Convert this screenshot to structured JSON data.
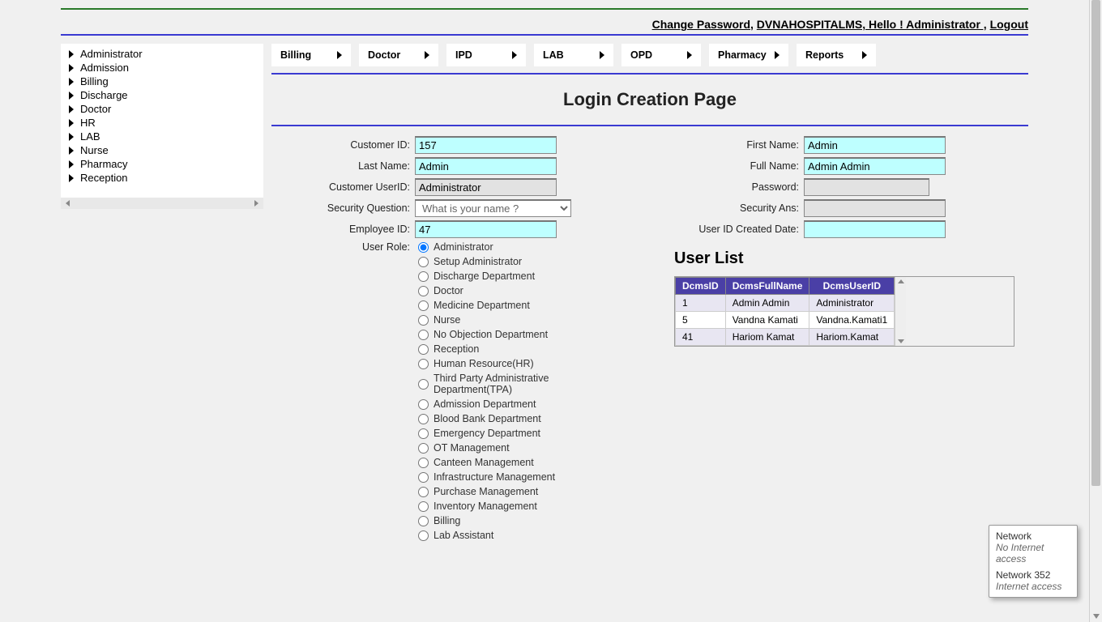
{
  "header": {
    "change_password": "Change Password",
    "title_and_greeting": "DVNAHOSPITALMS, Hello ! Administrator ,",
    "logout": "Logout"
  },
  "sidebar": {
    "items": [
      {
        "label": "Administrator"
      },
      {
        "label": "Admission"
      },
      {
        "label": "Billing"
      },
      {
        "label": "Discharge"
      },
      {
        "label": "Doctor"
      },
      {
        "label": "HR"
      },
      {
        "label": "LAB"
      },
      {
        "label": "Nurse"
      },
      {
        "label": "Pharmacy"
      },
      {
        "label": "Reception"
      }
    ]
  },
  "topmenu": [
    {
      "label": "Billing"
    },
    {
      "label": "Doctor"
    },
    {
      "label": "IPD"
    },
    {
      "label": "LAB"
    },
    {
      "label": "OPD"
    },
    {
      "label": "Pharmacy"
    },
    {
      "label": "Reports"
    }
  ],
  "page": {
    "title": "Login Creation Page"
  },
  "form": {
    "labels": {
      "customer_id": "Customer ID:",
      "first_name": "First Name:",
      "last_name": "Last Name:",
      "full_name": "Full Name:",
      "customer_userid": "Customer UserID:",
      "password": "Password:",
      "security_question": "Security Question:",
      "security_ans": "Security Ans:",
      "employee_id": "Employee ID:",
      "created_date": "User ID Created Date:",
      "user_role": "User Role:"
    },
    "values": {
      "customer_id": "157",
      "first_name": "Admin",
      "last_name": "Admin",
      "full_name": "Admin Admin",
      "customer_userid": "Administrator",
      "password": "",
      "security_question": "What is your name ?",
      "security_ans": "",
      "employee_id": "47",
      "created_date": ""
    },
    "roles": [
      "Administrator",
      "Setup Administrator",
      "Discharge Department",
      "Doctor",
      "Medicine Department",
      "Nurse",
      "No Objection Department",
      "Reception",
      "Human Resource(HR)",
      "Third Party Administrative Department(TPA)",
      "Admission Department",
      "Blood Bank Department",
      "Emergency Department",
      "OT Management",
      "Canteen Management",
      "Infrastructure Management",
      "Purchase Management",
      "Inventory Management",
      "Billing",
      "Lab Assistant"
    ],
    "selected_role_index": 0
  },
  "userlist": {
    "title": "User List",
    "columns": [
      "DcmsID",
      "DcmsFullName",
      "DcmsUserID"
    ],
    "rows": [
      {
        "id": "1",
        "name": "Admin Admin",
        "user": "Administrator"
      },
      {
        "id": "5",
        "name": "Vandna Kamati",
        "user": "Vandna.Kamati1"
      },
      {
        "id": "41",
        "name": "Hariom Kamat",
        "user": "Hariom.Kamat"
      }
    ]
  },
  "tooltip": {
    "line1": "Network",
    "line2": "No Internet access",
    "line3": "Network  352",
    "line4": "Internet access"
  }
}
